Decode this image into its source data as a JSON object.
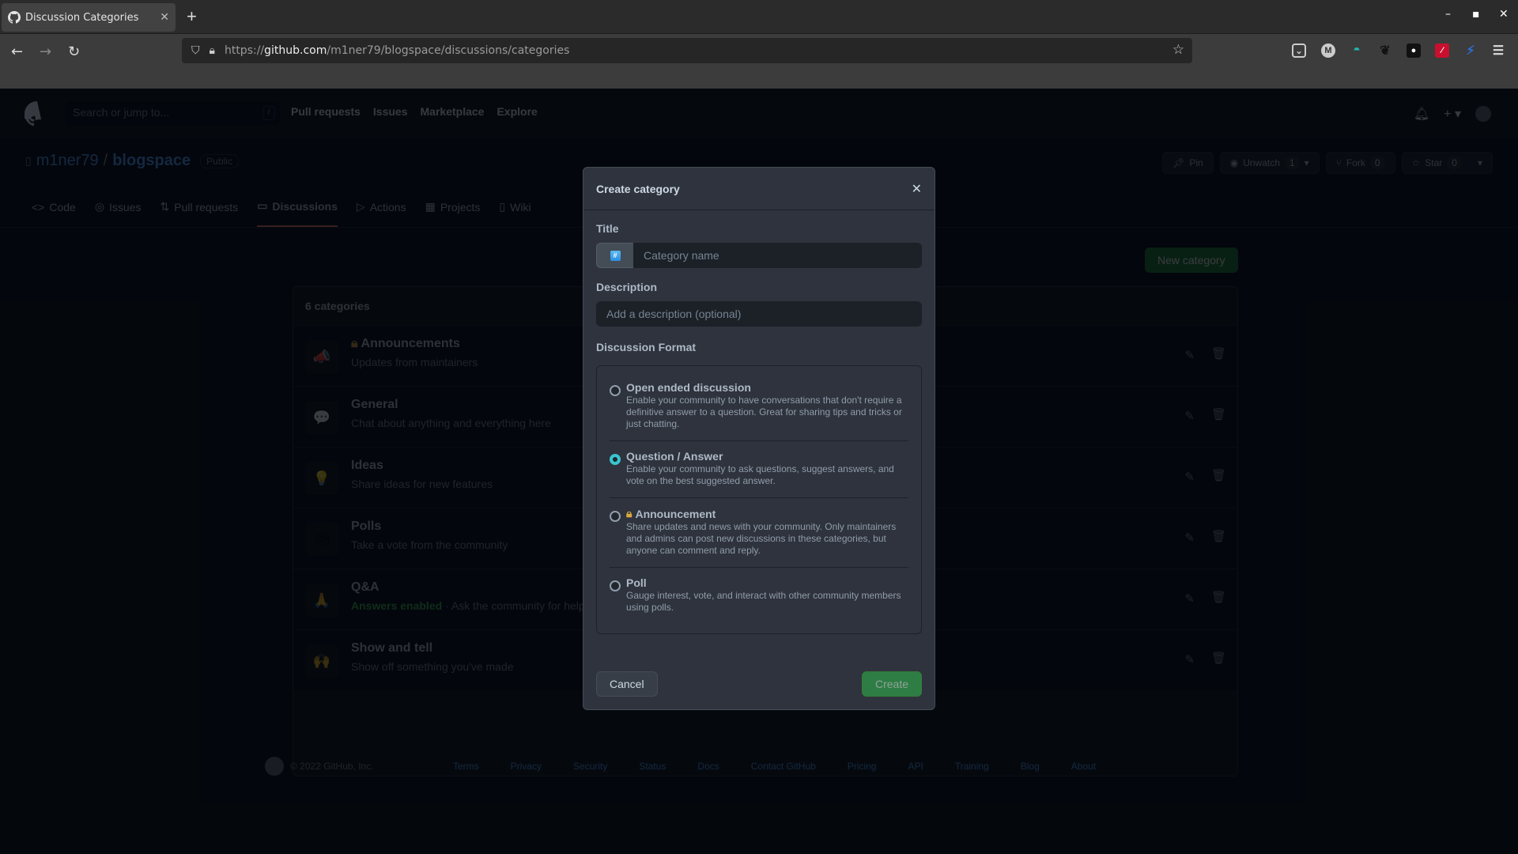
{
  "browser": {
    "tab_title": "Discussion Categories",
    "new_tab_label": "+",
    "url_scheme": "https://",
    "url_host": "github.com",
    "url_path": "/m1ner79/blogspace/discussions/categories",
    "extensions": [
      "pocket-icon",
      "m-extension-icon",
      "vpn-icon",
      "gimp-paw-icon",
      "github-icon",
      "magic-wand-icon",
      "blue-extension-icon"
    ]
  },
  "github": {
    "search_placeholder": "Search or jump to...",
    "search_shortcut": "/",
    "nav": [
      "Pull requests",
      "Issues",
      "Marketplace",
      "Explore"
    ],
    "repo": {
      "owner": "m1ner79",
      "separator": "/",
      "name": "blogspace",
      "visibility": "Public"
    },
    "repo_actions": {
      "pin": "Pin",
      "unwatch": "Unwatch",
      "unwatch_count": "1",
      "fork": "Fork",
      "fork_count": "0",
      "star": "Star",
      "star_count": "0"
    },
    "tabs": [
      {
        "label": "Code",
        "icon": "<>"
      },
      {
        "label": "Issues",
        "icon": "◎"
      },
      {
        "label": "Pull requests",
        "icon": "⇅"
      },
      {
        "label": "Discussions",
        "icon": "▭",
        "active": true
      },
      {
        "label": "Actions",
        "icon": "▷"
      },
      {
        "label": "Projects",
        "icon": "▦"
      },
      {
        "label": "Wiki",
        "icon": "▯"
      }
    ],
    "new_category_label": "New category",
    "categories_count_label": "6 categories",
    "categories": [
      {
        "emoji": "📣",
        "name": "Announcements",
        "locked": true,
        "description": "Updates from maintainers"
      },
      {
        "emoji": "💬",
        "name": "General",
        "description": "Chat about anything and everything here"
      },
      {
        "emoji": "💡",
        "name": "Ideas",
        "description": "Share ideas for new features"
      },
      {
        "emoji": "🗳",
        "name": "Polls",
        "description": "Take a vote from the community"
      },
      {
        "emoji": "🙏",
        "name": "Q&A",
        "answers_label": "Answers enabled",
        "description": "Ask the community for help"
      },
      {
        "emoji": "🙌",
        "name": "Show and tell",
        "description": "Show off something you've made"
      }
    ],
    "footer": {
      "copyright": "© 2022 GitHub, Inc.",
      "links": [
        "Terms",
        "Privacy",
        "Security",
        "Status",
        "Docs",
        "Contact GitHub",
        "Pricing",
        "API",
        "Training",
        "Blog",
        "About"
      ]
    }
  },
  "modal": {
    "title": "Create category",
    "title_label": "Title",
    "title_placeholder": "Category name",
    "title_value": "",
    "emoji_label": "#",
    "description_label": "Description",
    "description_placeholder": "Add a description (optional)",
    "description_value": "",
    "format_label": "Discussion Format",
    "formats": [
      {
        "title": "Open ended discussion",
        "description": "Enable your community to have conversations that don't require a definitive answer to a question. Great for sharing tips and tricks or just chatting.",
        "checked": false
      },
      {
        "title": "Question / Answer",
        "description": "Enable your community to ask questions, suggest answers, and vote on the best suggested answer.",
        "checked": true
      },
      {
        "title": "Announcement",
        "locked": true,
        "description": "Share updates and news with your community. Only maintainers and admins can post new discussions in these categories, but anyone can comment and reply.",
        "checked": false
      },
      {
        "title": "Poll",
        "description": "Gauge interest, vote, and interact with other community members using polls.",
        "checked": false
      }
    ],
    "cancel_label": "Cancel",
    "create_label": "Create"
  }
}
